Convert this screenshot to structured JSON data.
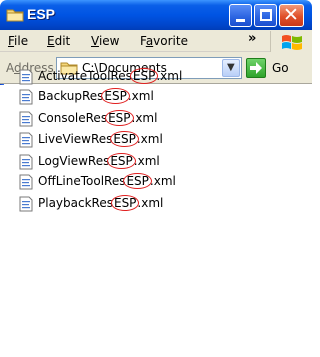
{
  "window": {
    "title": "ESP",
    "accent": "#0054e3"
  },
  "menu": {
    "items": [
      {
        "label": "File",
        "mnemonic": "F",
        "rest": "ile"
      },
      {
        "label": "Edit",
        "mnemonic": "E",
        "rest": "dit"
      },
      {
        "label": "View",
        "mnemonic": "V",
        "rest": "iew"
      },
      {
        "label": "Favorites",
        "pre": "F",
        "mnemonic": "a",
        "rest": "vorite"
      }
    ],
    "overflow": "»"
  },
  "address": {
    "label_pre": "A",
    "label_mnemonic": "d",
    "label_rest": "dress",
    "value": "C:\\Documents",
    "go_label": "Go"
  },
  "files": [
    {
      "prefix": "ActivateToolRes",
      "highlight": "ESP",
      "suffix": ".xml"
    },
    {
      "prefix": "BackupRes",
      "highlight": "ESP",
      "suffix": ".xml"
    },
    {
      "prefix": "ConsoleRes",
      "highlight": "ESP",
      "suffix": ".xml"
    },
    {
      "prefix": "LiveViewRes",
      "highlight": "ESP",
      "suffix": ".xml"
    },
    {
      "prefix": "LogViewRes",
      "highlight": "ESP",
      "suffix": ".xml"
    },
    {
      "prefix": "OffLineToolRes",
      "highlight": "ESP",
      "suffix": ".xml"
    },
    {
      "prefix": "PlaybackRes",
      "highlight": "ESP",
      "suffix": ".xml"
    }
  ],
  "icons": {
    "title": "folder-icon",
    "file": "xml-file-icon",
    "go": "go-arrow-icon",
    "logo": "windows-logo-icon"
  },
  "colors": {
    "highlight_circle": "#e02020"
  }
}
